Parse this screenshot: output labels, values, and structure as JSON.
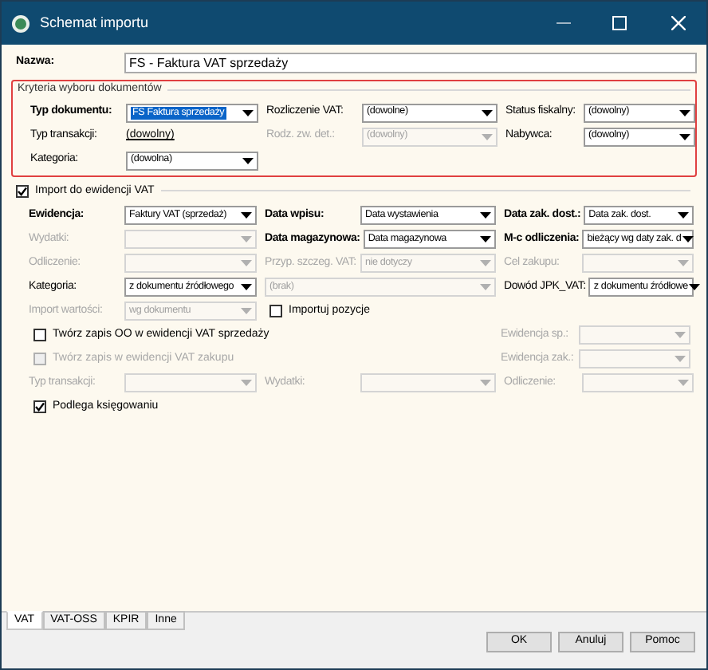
{
  "window": {
    "title": "Schemat importu"
  },
  "name_field": {
    "label": "Nazwa:",
    "value": "FS - Faktura VAT sprzedaży"
  },
  "criteria": {
    "title": "Kryteria wyboru dokumentów",
    "rows": [
      {
        "groups": [
          {
            "kind": "field",
            "label": "Typ dokumentu:",
            "bold": true,
            "value": "FS Faktura sprzedaży",
            "highlighted": true,
            "disabled": false
          },
          {
            "kind": "field",
            "label": "Rozliczenie VAT:",
            "bold": false,
            "value": "(dowolne)",
            "highlighted": false,
            "disabled": false
          },
          {
            "kind": "field",
            "label": "Status fiskalny:",
            "bold": false,
            "value": "(dowolny)",
            "highlighted": false,
            "disabled": false
          }
        ]
      },
      {
        "groups": [
          {
            "kind": "link",
            "label": "Typ transakcji:",
            "bold": false,
            "value": "(dowolny)",
            "disabled": false
          },
          {
            "kind": "field",
            "label": "Rodz. zw. det.:",
            "bold": false,
            "value": "(dowolny)",
            "highlighted": false,
            "disabled": true
          },
          {
            "kind": "field",
            "label": "Nabywca:",
            "bold": false,
            "value": "(dowolny)",
            "highlighted": false,
            "disabled": false
          }
        ]
      },
      {
        "groups": [
          {
            "kind": "field",
            "label": "Kategoria:",
            "bold": false,
            "value": "(dowolna)",
            "highlighted": false,
            "disabled": false
          }
        ]
      }
    ]
  },
  "vat": {
    "label": "Import do ewidencji VAT",
    "checked": true,
    "rows": [
      {
        "groups": [
          {
            "kind": "field",
            "label": "Ewidencja:",
            "bold": true,
            "value": "Faktury VAT (sprzedaż)",
            "disabled": false
          },
          {
            "kind": "field",
            "label": "Data wpisu:",
            "bold": true,
            "value": "Data wystawienia",
            "disabled": false
          },
          {
            "kind": "field",
            "label": "Data zak. dost.:",
            "bold": true,
            "value": "Data zak. dost.",
            "disabled": false
          }
        ]
      },
      {
        "groups": [
          {
            "kind": "field",
            "label": "Wydatki:",
            "bold": false,
            "disabled": true
          },
          {
            "kind": "field",
            "label": "Data magazynowa:",
            "bold": true,
            "value": "Data magazynowa",
            "disabled": false
          },
          {
            "kind": "field",
            "label": "M-c odliczenia:",
            "bold": true,
            "value": "bieżący wg daty zak. d",
            "disabled": false
          }
        ]
      },
      {
        "groups": [
          {
            "kind": "field",
            "label": "Odliczenie:",
            "bold": false,
            "disabled": true
          },
          {
            "kind": "field",
            "label": "Przyp. szczeg. VAT:",
            "bold": false,
            "value": "nie dotyczy",
            "disabled": true
          },
          {
            "kind": "field",
            "label": "Cel zakupu:",
            "bold": false,
            "disabled": true
          }
        ]
      },
      {
        "groups": [
          {
            "kind": "field",
            "label": "Kategoria:",
            "bold": false,
            "value": "z dokumentu źródłowego",
            "disabled": false
          },
          {
            "kind": "field",
            "value": "(brak)",
            "disabled": true
          },
          {
            "kind": "field",
            "label": "Dowód JPK_VAT:",
            "bold": false,
            "value": "z dokumentu źródłowe",
            "disabled": false
          }
        ]
      },
      {
        "groups": [
          {
            "kind": "field",
            "label": "Import wartości:",
            "bold": false,
            "value": "wg dokumentu",
            "disabled": true
          },
          {
            "kind": "check",
            "label": "Importuj pozycje",
            "checked": false,
            "disabled": false
          }
        ]
      },
      {
        "groups": [
          {
            "kind": "check",
            "label": "Twórz zapis OO w ewidencji VAT sprzedaży",
            "checked": false,
            "disabled": false
          },
          {
            "kind": "field",
            "label": "Ewidencja sp.:",
            "bold": false,
            "disabled": true
          }
        ]
      },
      {
        "groups": [
          {
            "kind": "check",
            "label": "Twórz zapis w ewidencji VAT zakupu",
            "checked": false,
            "disabled": true
          },
          {
            "kind": "field",
            "label": "Ewidencja zak.:",
            "bold": false,
            "disabled": true
          }
        ]
      },
      {
        "groups": [
          {
            "kind": "field",
            "label": "Typ transakcji:",
            "bold": false,
            "disabled": true
          },
          {
            "kind": "field",
            "label": "Wydatki:",
            "bold": false,
            "disabled": true
          },
          {
            "kind": "field",
            "label": "Odliczenie:",
            "bold": false,
            "disabled": true
          }
        ]
      },
      {
        "groups": [
          {
            "kind": "check",
            "label": "Podlega księgowaniu",
            "checked": true,
            "disabled": false
          }
        ]
      }
    ]
  },
  "tabs": [
    {
      "label": "VAT",
      "selected": true
    },
    {
      "label": "VAT-OSS",
      "selected": false
    },
    {
      "label": "KPIR",
      "selected": false
    },
    {
      "label": "Inne",
      "selected": false
    }
  ],
  "buttons": [
    "OK",
    "Anuluj",
    "Pomoc"
  ]
}
